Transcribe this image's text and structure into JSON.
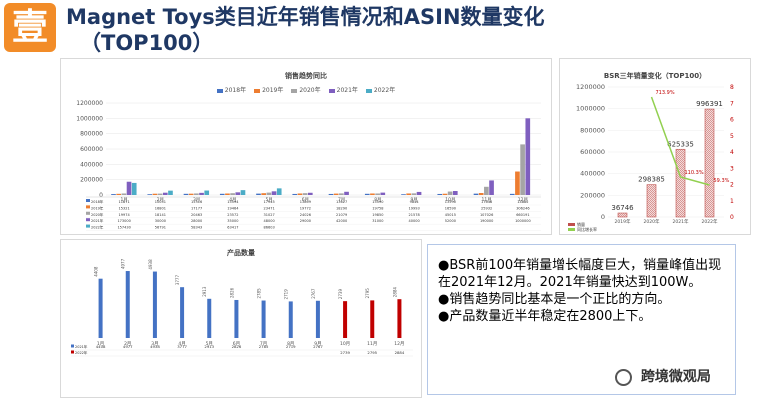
{
  "logo": {
    "text": "壹"
  },
  "title": {
    "line1": "Magnet Toys类目近年销售情况和ASIN数量变化",
    "line2": "（TOP100）"
  },
  "chart_data": [
    {
      "type": "bar",
      "title": "销售趋势同比",
      "series": [
        {
          "name": "2018年",
          "color": "#4472c4",
          "values": [
            11871,
            10051,
            15316,
            15594,
            17945,
            13809,
            13627,
            15590,
            9844,
            13590,
            17648,
            14882
          ]
        },
        {
          "name": "2019年",
          "color": "#ed7d31",
          "values": [
            15321,
            16801,
            17177,
            19464,
            23471,
            19772,
            18290,
            19758,
            19993,
            16590,
            25932,
            306246
          ]
        },
        {
          "name": "2020年",
          "color": "#a5a5a5",
          "values": [
            19974,
            18141,
            20463,
            23572,
            31027,
            24026,
            21079,
            19850,
            21578,
            45015,
            107026,
            660191
          ]
        },
        {
          "name": "2021年",
          "color": "#7f5fbf",
          "values": [
            173000,
            30000,
            28000,
            35000,
            48000,
            29000,
            42000,
            31000,
            40000,
            52000,
            190000,
            1000000
          ]
        },
        {
          "name": "2022年",
          "color": "#4bacc6",
          "values": [
            157430,
            56791,
            58343,
            63417,
            86603,
            null,
            null,
            null,
            null,
            null,
            null,
            null
          ]
        }
      ],
      "categories": [
        "1月",
        "2月",
        "3月",
        "4月",
        "5月",
        "6月",
        "7月",
        "8月",
        "9月",
        "10月",
        "11月",
        "12月"
      ],
      "ylim": [
        0,
        1200000
      ],
      "yticks": [
        "0",
        "200000",
        "400000",
        "600000",
        "800000",
        "1000000",
        "1200000"
      ]
    },
    {
      "type": "bar",
      "title": "BSR三年销量变化（TOP100）",
      "categories": [
        "2019年",
        "2020年",
        "2021年",
        "2022年"
      ],
      "values": [
        36746,
        298385,
        625335,
        996391
      ],
      "value_labels": [
        "36746",
        "298385",
        "625335",
        "996391"
      ],
      "line_labels": [
        "713.9%",
        "110.3%",
        "59.3%"
      ],
      "ylim": [
        0,
        1200000
      ],
      "yticks": [
        "0",
        "200000",
        "400000",
        "600000",
        "800000",
        "1000000",
        "1200000"
      ],
      "y2ticks": [
        "0",
        "1",
        "2",
        "3",
        "4",
        "5",
        "6",
        "7",
        "8"
      ],
      "legend": [
        "销量",
        "同比增长率"
      ]
    },
    {
      "type": "bar",
      "title": "产品数量",
      "categories": [
        "1月",
        "2月",
        "3月",
        "4月",
        "5月",
        "6月",
        "7月",
        "8月",
        "9月",
        "10月",
        "11月",
        "12月"
      ],
      "series": [
        {
          "name": "2021年",
          "color": "#4472c4",
          "values": [
            4408,
            4977,
            4938,
            3777,
            2913,
            2826,
            2785,
            2719,
            2767,
            null,
            null,
            null
          ]
        },
        {
          "name": "2022年",
          "color": "#c00000",
          "values": [
            null,
            null,
            null,
            null,
            null,
            null,
            null,
            null,
            null,
            2739,
            2795,
            2884
          ]
        }
      ],
      "value_labels": [
        "4408",
        "4977",
        "4938",
        "3777",
        "2913",
        "2826",
        "2785",
        "2719",
        "2767",
        "2739",
        "2795",
        "2884"
      ]
    }
  ],
  "bullets": [
    "●BSR前100年销量增长幅度巨大，销量峰值出现在2021年12月。2021年销量快达到100W。",
    "●销售趋势同比基本是一个正比的方向。",
    "●产品数量近半年稳定在2800上下。"
  ],
  "footer": {
    "text": "跨境微观局"
  }
}
